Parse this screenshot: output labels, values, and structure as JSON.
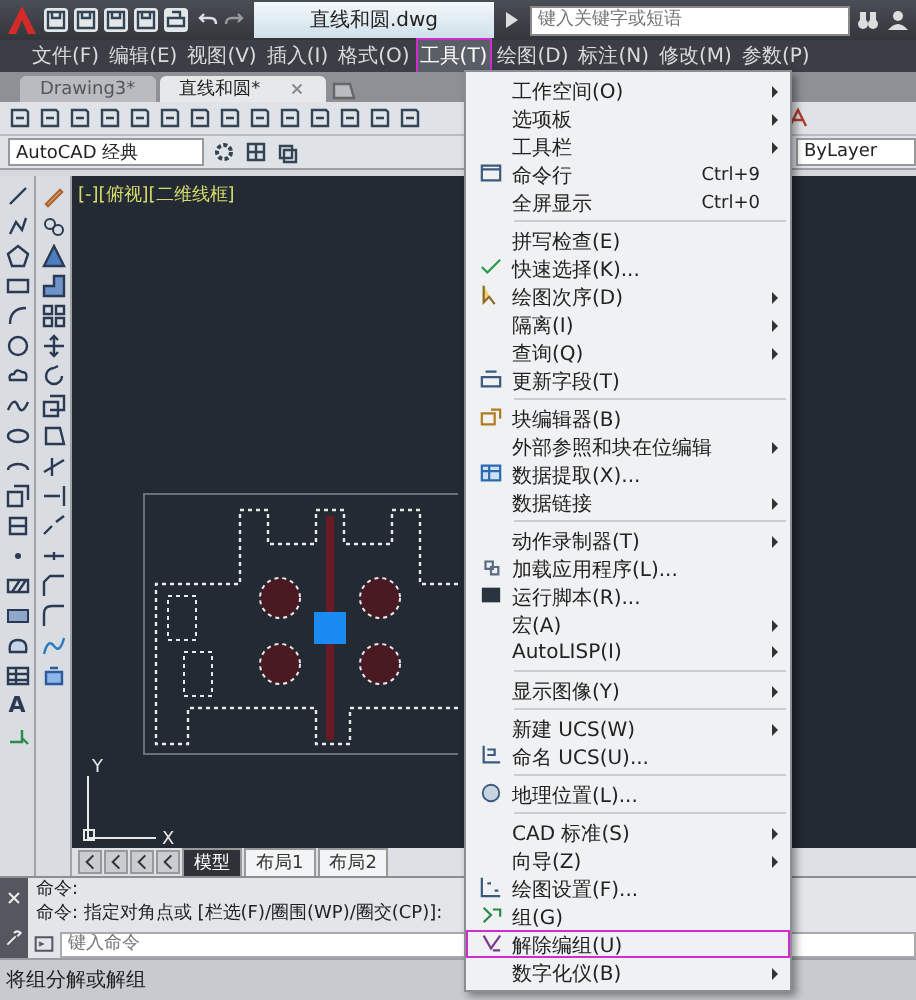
{
  "title_bar": {
    "title": "直线和圆.dwg",
    "search": {
      "placeholder": "键入关键字或短语"
    }
  },
  "menu_bar": [
    {
      "label": "文件(F)",
      "selected": false
    },
    {
      "label": "编辑(E)",
      "selected": false
    },
    {
      "label": "视图(V)",
      "selected": false
    },
    {
      "label": "插入(I)",
      "selected": false
    },
    {
      "label": "格式(O)",
      "selected": false
    },
    {
      "label": "工具(T)",
      "selected": true
    },
    {
      "label": "绘图(D)",
      "selected": false
    },
    {
      "label": "标注(N)",
      "selected": false
    },
    {
      "label": "修改(M)",
      "selected": false
    },
    {
      "label": "参数(P)",
      "selected": false
    }
  ],
  "doc_tabs": [
    {
      "label": "Drawing3*",
      "selected": false
    },
    {
      "label": "直线和圆*",
      "selected": true
    }
  ],
  "workspace": {
    "value": "AutoCAD 经典"
  },
  "layer": {
    "value": "ByLayer"
  },
  "draw_toolbar": {
    "text_tool": "A"
  },
  "viewport": {
    "label": "[-][俯视][二维线框]"
  },
  "ucs": {
    "x": "X",
    "y": "Y"
  },
  "layout_tabs": [
    {
      "label": "模型",
      "selected": true
    },
    {
      "label": "布局1",
      "selected": false
    },
    {
      "label": "布局2",
      "selected": false
    }
  ],
  "command": {
    "history": [
      "命令:",
      "命令: 指定对角点或 [栏选(F)/圈围(WP)/圈交(CP)]:"
    ],
    "placeholder": "键入命令"
  },
  "status_bar": {
    "text": "将组分解或解组"
  },
  "tools_menu": {
    "items": [
      {
        "kind": "item",
        "label": "工作空间(O)",
        "submenu": true,
        "highlighted": false
      },
      {
        "kind": "item",
        "label": "选项板",
        "submenu": true,
        "highlighted": false
      },
      {
        "kind": "item",
        "label": "工具栏",
        "submenu": true,
        "highlighted": false
      },
      {
        "kind": "item",
        "label": "命令行",
        "shortcut": "Ctrl+9",
        "submenu": false,
        "highlighted": false
      },
      {
        "kind": "item",
        "label": "全屏显示",
        "shortcut": "Ctrl+0",
        "submenu": false,
        "highlighted": false
      },
      {
        "kind": "separator"
      },
      {
        "kind": "item",
        "label": "拼写检查(E)",
        "submenu": false,
        "highlighted": false
      },
      {
        "kind": "item",
        "label": "快速选择(K)...",
        "submenu": false,
        "highlighted": false
      },
      {
        "kind": "item",
        "label": "绘图次序(D)",
        "submenu": true,
        "highlighted": false
      },
      {
        "kind": "item",
        "label": "隔离(I)",
        "submenu": true,
        "highlighted": false
      },
      {
        "kind": "item",
        "label": "查询(Q)",
        "submenu": true,
        "highlighted": false
      },
      {
        "kind": "item",
        "label": "更新字段(T)",
        "submenu": false,
        "highlighted": false
      },
      {
        "kind": "separator"
      },
      {
        "kind": "item",
        "label": "块编辑器(B)",
        "submenu": false,
        "highlighted": false
      },
      {
        "kind": "item",
        "label": "外部参照和块在位编辑",
        "submenu": true,
        "highlighted": false
      },
      {
        "kind": "item",
        "label": "数据提取(X)...",
        "submenu": false,
        "highlighted": false
      },
      {
        "kind": "item",
        "label": "数据链接",
        "submenu": true,
        "highlighted": false
      },
      {
        "kind": "separator"
      },
      {
        "kind": "item",
        "label": "动作录制器(T)",
        "submenu": true,
        "highlighted": false
      },
      {
        "kind": "item",
        "label": "加载应用程序(L)...",
        "submenu": false,
        "highlighted": false
      },
      {
        "kind": "item",
        "label": "运行脚本(R)...",
        "submenu": false,
        "highlighted": false
      },
      {
        "kind": "item",
        "label": "宏(A)",
        "submenu": true,
        "highlighted": false
      },
      {
        "kind": "item",
        "label": "AutoLISP(I)",
        "submenu": true,
        "highlighted": false
      },
      {
        "kind": "separator"
      },
      {
        "kind": "item",
        "label": "显示图像(Y)",
        "submenu": true,
        "highlighted": false
      },
      {
        "kind": "separator"
      },
      {
        "kind": "item",
        "label": "新建 UCS(W)",
        "submenu": true,
        "highlighted": false
      },
      {
        "kind": "item",
        "label": "命名 UCS(U)...",
        "submenu": false,
        "highlighted": false
      },
      {
        "kind": "separator"
      },
      {
        "kind": "item",
        "label": "地理位置(L)...",
        "submenu": false,
        "highlighted": false
      },
      {
        "kind": "separator"
      },
      {
        "kind": "item",
        "label": "CAD 标准(S)",
        "submenu": true,
        "highlighted": false
      },
      {
        "kind": "item",
        "label": "向导(Z)",
        "submenu": true,
        "highlighted": false
      },
      {
        "kind": "item",
        "label": "绘图设置(F)...",
        "submenu": false,
        "highlighted": false
      },
      {
        "kind": "item",
        "label": "组(G)",
        "submenu": false,
        "highlighted": false
      },
      {
        "kind": "item",
        "label": "解除编组(U)",
        "submenu": false,
        "highlighted": true
      },
      {
        "kind": "item",
        "label": "数字化仪(B)",
        "submenu": true,
        "highlighted": false
      }
    ]
  }
}
